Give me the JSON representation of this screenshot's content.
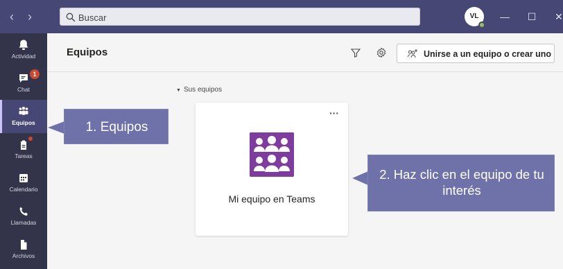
{
  "titlebar": {
    "search_placeholder": "Buscar",
    "avatar_initials": "VL",
    "back_icon": "chevron-left-icon",
    "forward_icon": "chevron-right-icon",
    "minimize_icon": "minimize-icon",
    "maximize_icon": "maximize-icon",
    "close_icon": "close-icon"
  },
  "rail": {
    "items": [
      {
        "label": "Actividad",
        "icon": "bell-icon"
      },
      {
        "label": "Chat",
        "icon": "chat-icon",
        "badge": "1"
      },
      {
        "label": "Equipos",
        "icon": "teams-icon",
        "active": true
      },
      {
        "label": "Tareas",
        "icon": "tasks-icon",
        "dot": true
      },
      {
        "label": "Calendario",
        "icon": "calendar-icon"
      },
      {
        "label": "Llamadas",
        "icon": "phone-icon"
      },
      {
        "label": "Archivos",
        "icon": "file-icon"
      }
    ]
  },
  "header": {
    "title": "Equipos",
    "join_label": "Unirse a un equipo o crear uno"
  },
  "section": {
    "label": "Sus equipos"
  },
  "team_card": {
    "name": "Mi equipo en Teams",
    "avatar_color": "#7e3d9e"
  },
  "callouts": {
    "first": "1. Equipos",
    "second": "2. Haz clic en el equipo de tu interés"
  },
  "colors": {
    "titlebar": "#464775",
    "rail": "#33344a",
    "callout": "#6e72a9",
    "badge": "#cc4a31"
  }
}
